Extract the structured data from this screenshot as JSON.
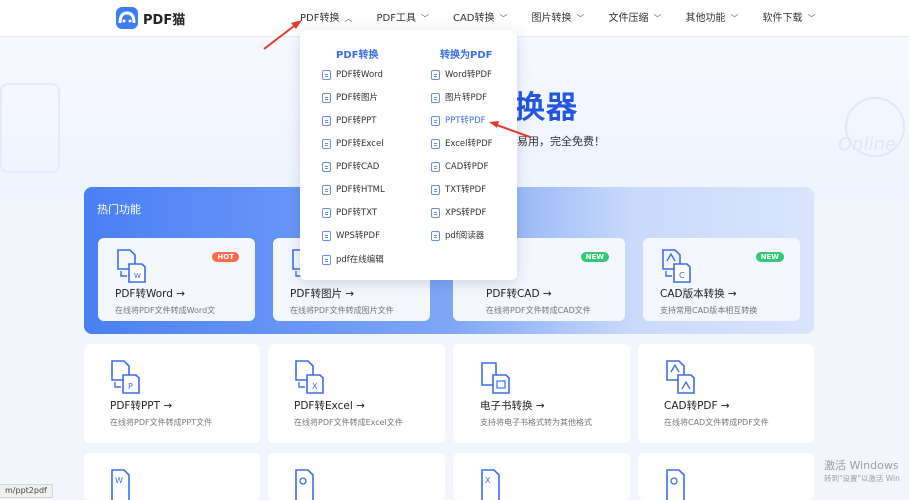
{
  "logo": {
    "text": "PDF猫"
  },
  "nav": [
    {
      "label": "PDF转换"
    },
    {
      "label": "PDF工具"
    },
    {
      "label": "CAD转换"
    },
    {
      "label": "图片转换"
    },
    {
      "label": "文件压缩"
    },
    {
      "label": "其他功能"
    },
    {
      "label": "软件下载"
    }
  ],
  "dropdown": {
    "left_heading": "PDF转换",
    "right_heading": "转换为PDF",
    "left_items": [
      "PDF转Word",
      "PDF转图片",
      "PDF转PPT",
      "PDF转Excel",
      "PDF转CAD",
      "PDF转HTML",
      "PDF转TXT",
      "WPS转PDF",
      "pdf在线编辑"
    ],
    "right_items": [
      "Word转PDF",
      "图片转PDF",
      "PPT转PDF",
      "Excel转PDF",
      "CAD转PDF",
      "TXT转PDF",
      "XPS转PDF",
      "pdf阅读器"
    ],
    "highlighted": "PPT转PDF"
  },
  "hero": {
    "title_fragment": "换器",
    "subtitle_fragment": "易用，完全免费！",
    "deco_text": "Online"
  },
  "hot_section": {
    "title": "热门功能",
    "cards": [
      {
        "title": "PDF转Word →",
        "desc": "在线将PDF文件转成Word文",
        "badge": "HOT"
      },
      {
        "title": "PDF转图片 →",
        "desc": "在线将PDF文件转成图片文件",
        "badge": ""
      },
      {
        "title": "PDF转CAD →",
        "desc": "在线将PDF文件转成CAD文件",
        "badge": "NEW"
      },
      {
        "title": "CAD版本转换 →",
        "desc": "支持常用CAD版本相互转换",
        "badge": "NEW"
      }
    ]
  },
  "tools": [
    {
      "title": "PDF转PPT →",
      "desc": "在线将PDF文件转成PPT文件"
    },
    {
      "title": "PDF转Excel →",
      "desc": "在线将PDF文件转成Excel文件"
    },
    {
      "title": "电子书转换 →",
      "desc": "支持将电子书格式转为其他格式"
    },
    {
      "title": "CAD转PDF →",
      "desc": "在线将CAD文件转成PDF文件"
    }
  ],
  "status_url": "m/ppt2pdf",
  "watermark": {
    "line1": "激活 Windows",
    "line2": "转到\"设置\"以激活 Win"
  },
  "colors": {
    "accent": "#3d6ee8",
    "hot": "#ff6a4d",
    "new": "#34c87a"
  }
}
